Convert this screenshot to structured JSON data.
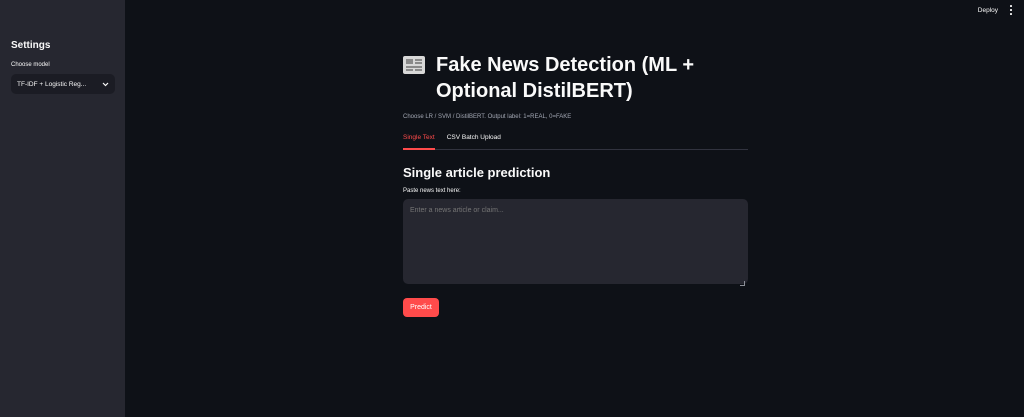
{
  "sidebar": {
    "title": "Settings",
    "model_label": "Choose model",
    "model_selected": "TF-IDF + Logistic Reg..."
  },
  "toolbar": {
    "deploy_label": "Deploy"
  },
  "main": {
    "title": "Fake News Detection (ML + Optional DistilBERT)",
    "caption": "Choose LR / SVM / DistilBERT. Output label: 1=REAL, 0=FAKE",
    "tabs": [
      {
        "label": "Single Text",
        "active": true
      },
      {
        "label": "CSV Batch Upload",
        "active": false
      }
    ],
    "section_title": "Single article prediction",
    "input_label": "Paste news text here:",
    "input_placeholder": "Enter a news article or claim...",
    "predict_label": "Predict"
  },
  "colors": {
    "background": "#0e1117",
    "sidebar": "#262730",
    "accent": "#ff4b4b"
  }
}
